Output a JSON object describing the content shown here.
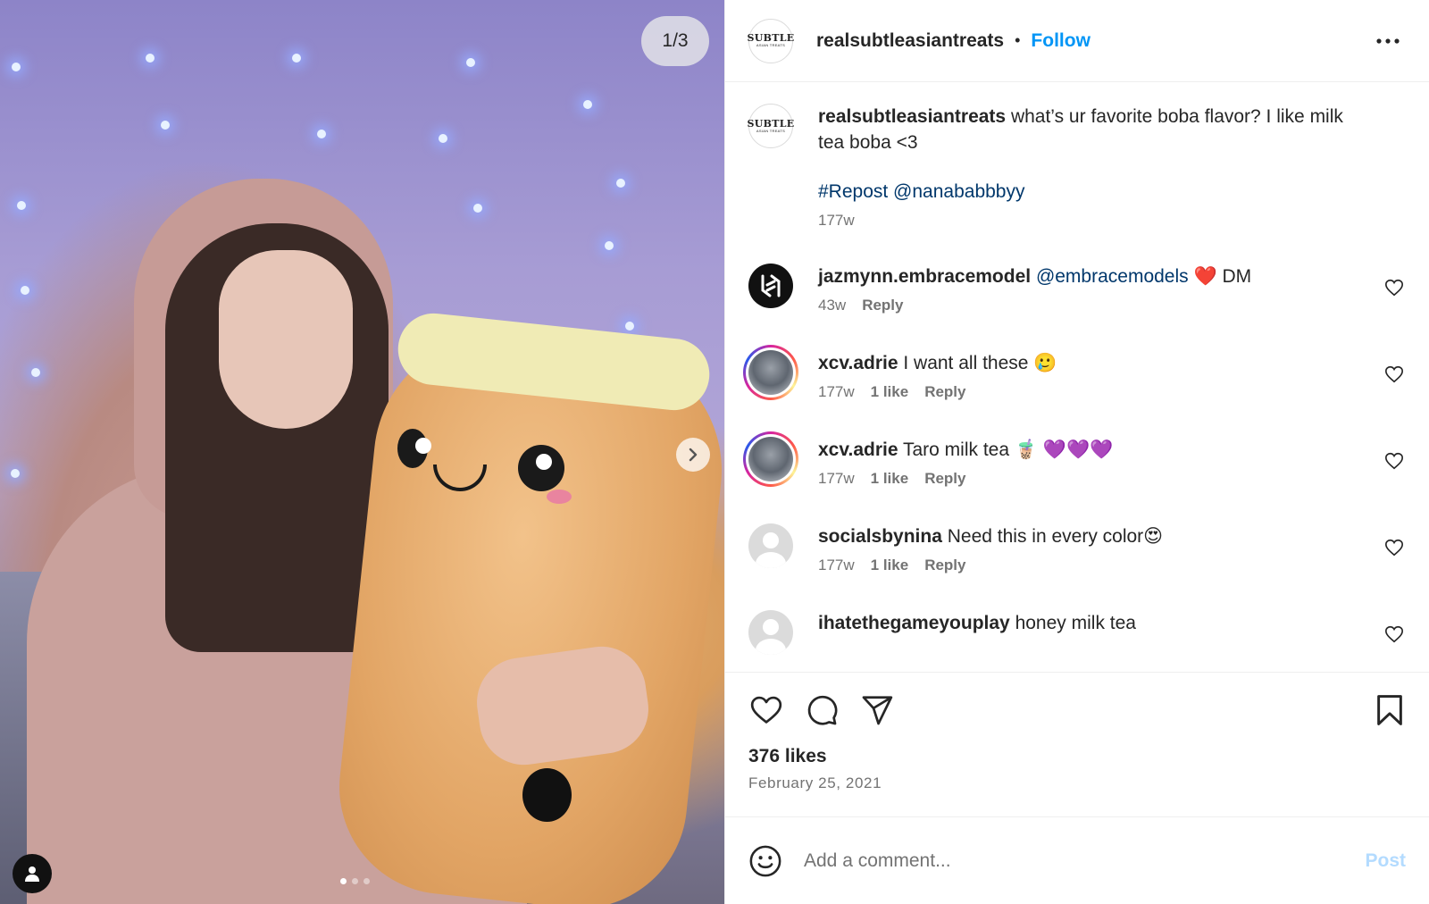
{
  "media": {
    "counter": "1/3",
    "slide_count": 3,
    "active_slide": 1,
    "image_description_icon": "person-icon"
  },
  "header": {
    "avatar_text_main": "SUBTLE",
    "avatar_text_sub": "ASIAN TREATS",
    "username": "realsubtleasiantreats",
    "separator": "•",
    "follow_label": "Follow",
    "accent_color": "#0095f6"
  },
  "caption": {
    "username": "realsubtleasiantreats",
    "text": "what’s ur favorite boba flavor? I like milk tea boba <3",
    "tags": "#Repost @nanababbbyy",
    "time": "177w"
  },
  "comments": [
    {
      "username": "jazmynn.embracemodel",
      "mention": "@embracemodels",
      "text": "❤️ DM",
      "time": "43w",
      "likes": "",
      "reply": "Reply",
      "avatar": "dark-logo"
    },
    {
      "username": "xcv.adrie",
      "text": "I want all these 🥲",
      "time": "177w",
      "likes": "1 like",
      "reply": "Reply",
      "avatar": "story-ring"
    },
    {
      "username": "xcv.adrie",
      "text": "Taro milk tea 🧋 💜💜💜",
      "time": "177w",
      "likes": "1 like",
      "reply": "Reply",
      "avatar": "story-ring"
    },
    {
      "username": "socialsbynina",
      "text": "Need this in every color😍",
      "time": "177w",
      "likes": "1 like",
      "reply": "Reply",
      "avatar": "default"
    },
    {
      "username": "ihatethegameyouplay",
      "text": "honey milk tea",
      "avatar": "default"
    }
  ],
  "actions": {
    "likes": "376 likes",
    "date": "February 25, 2021"
  },
  "composer": {
    "placeholder": "Add a comment...",
    "post_label": "Post",
    "post_color": "#b3dbff"
  }
}
